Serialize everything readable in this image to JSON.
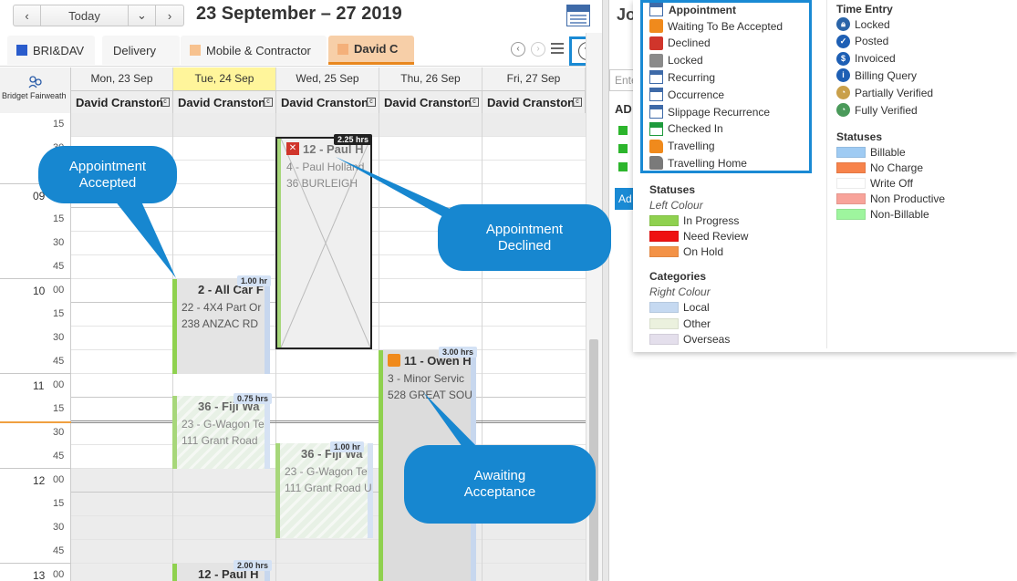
{
  "toolbar": {
    "prev": "‹",
    "today": "Today",
    "dropdown": "⌄",
    "next": "›",
    "range_title": "23 September – 27 2019"
  },
  "tabs": [
    {
      "label": "BRI&DAV",
      "color": "#2a5ccc"
    },
    {
      "label": "Delivery",
      "color": ""
    },
    {
      "label": "Mobile & Contractor",
      "color": "#f7c28f"
    },
    {
      "label": "David C",
      "color": "#f7c28f"
    }
  ],
  "tab_controls": {
    "prev": "‹",
    "next": "›",
    "help": "?"
  },
  "corner_label": "Bridget Fairweath",
  "days": [
    {
      "label": "Mon, 23 Sep",
      "resource": "David Cranston"
    },
    {
      "label": "Tue, 24 Sep",
      "resource": "David Cranston"
    },
    {
      "label": "Wed, 25 Sep",
      "resource": "David Cranston"
    },
    {
      "label": "Thu, 26 Sep",
      "resource": "David Cranston"
    },
    {
      "label": "Fri, 27 Sep",
      "resource": "David Cranston"
    }
  ],
  "resource_icon": "c",
  "time_rows": [
    {
      "hour": "",
      "min": "15"
    },
    {
      "hour": "",
      "min": "30"
    },
    {
      "hour": "",
      "min": "45"
    },
    {
      "hour": "09",
      "min": "00"
    },
    {
      "hour": "",
      "min": "15"
    },
    {
      "hour": "",
      "min": "30"
    },
    {
      "hour": "",
      "min": "45"
    },
    {
      "hour": "10",
      "min": "00"
    },
    {
      "hour": "",
      "min": "15"
    },
    {
      "hour": "",
      "min": "30"
    },
    {
      "hour": "",
      "min": "45"
    },
    {
      "hour": "11",
      "min": "00"
    },
    {
      "hour": "",
      "min": "15"
    },
    {
      "hour": "",
      "min": "30"
    },
    {
      "hour": "",
      "min": "45"
    },
    {
      "hour": "12",
      "min": "00"
    },
    {
      "hour": "",
      "min": "15"
    },
    {
      "hour": "",
      "min": "30"
    },
    {
      "hour": "",
      "min": "45"
    },
    {
      "hour": "13",
      "min": "00"
    }
  ],
  "appointments": [
    {
      "title": "12 - Paul H",
      "line2": "4 - Paul Holland",
      "line3": "36 BURLEIGH",
      "hours": "2.25 hrs",
      "status": "declined"
    },
    {
      "title": "2 - All Car F",
      "line2": "22 - 4X4 Part Or",
      "line3": "238 ANZAC RD",
      "hours": "1.00 hr",
      "status": "accepted"
    },
    {
      "title": "11 - Owen H",
      "line2": "3 - Minor Servic",
      "line3": "528 GREAT SOU",
      "hours": "3.00 hrs",
      "status": "waiting"
    },
    {
      "title": "36 - Fiji Wa",
      "line2": "23 - G-Wagon Te",
      "line3": "111 Grant Road",
      "hours": "0.75 hrs",
      "status": "accepted"
    },
    {
      "title": "36 - Fiji Wa",
      "line2": "23 - G-Wagon Te",
      "line3": "111 Grant Road U",
      "hours": "1.00 hr",
      "status": "accepted"
    },
    {
      "title": "12 - Paul H",
      "line2": "",
      "line3": "",
      "hours": "2.00 hrs",
      "status": "accepted"
    }
  ],
  "callouts": {
    "accepted": "Appointment Accepted",
    "declined": "Appointment Declined",
    "awaiting": "Awaiting Acceptance"
  },
  "side_panel": {
    "title": "Jo",
    "search_placeholder": "Ente",
    "section_label": "AD",
    "button_label": "Ad"
  },
  "legend": {
    "appointment_header": "Appointment",
    "appointment_items": [
      {
        "label": "Waiting To Be Accepted",
        "icon": "hourglass-calendar-icon"
      },
      {
        "label": "Declined",
        "icon": "declined-x-icon"
      },
      {
        "label": "Locked",
        "icon": "locked-calendar-icon"
      },
      {
        "label": "Recurring",
        "icon": "recurring-calendar-icon"
      },
      {
        "label": "Occurrence",
        "icon": "occurrence-calendar-icon"
      },
      {
        "label": "Slippage Recurrence",
        "icon": "slippage-calendar-icon"
      },
      {
        "label": "Checked In",
        "icon": "checked-in-icon"
      },
      {
        "label": "Travelling",
        "icon": "truck-icon"
      },
      {
        "label": "Travelling Home",
        "icon": "truck-home-icon"
      }
    ],
    "statuses_header": "Statuses",
    "statuses_sub": "Left Colour",
    "statuses": [
      {
        "label": "In Progress",
        "color": "#8fd14f"
      },
      {
        "label": "Need Review",
        "color": "#ee1111"
      },
      {
        "label": "On Hold",
        "color": "#f39247"
      }
    ],
    "categories_header": "Categories",
    "categories_sub": "Right Colour",
    "categories": [
      {
        "label": "Local",
        "color": "#c5d9f1"
      },
      {
        "label": "Other",
        "color": "#ebf1de"
      },
      {
        "label": "Overseas",
        "color": "#e4dfec"
      }
    ],
    "time_entry_header": "Time Entry",
    "time_entry": [
      {
        "label": "Locked",
        "icon": "lock-icon",
        "color": "#2a64a8"
      },
      {
        "label": "Posted",
        "icon": "check-icon",
        "color": "#1e5fb4"
      },
      {
        "label": "Invoiced",
        "icon": "dollar-icon",
        "color": "#1e5fb4"
      },
      {
        "label": "Billing Query",
        "icon": "info-icon",
        "color": "#1e5fb4"
      },
      {
        "label": "Partially Verified",
        "icon": "clock-icon",
        "color": "#c9a04a"
      },
      {
        "label": "Fully Verified",
        "icon": "clock-green-icon",
        "color": "#4a9a5a"
      }
    ],
    "statuses2_header": "Statuses",
    "statuses2": [
      {
        "label": "Billable",
        "color": "#9fcbf3"
      },
      {
        "label": "No Charge",
        "color": "#f7834b"
      },
      {
        "label": "Write Off",
        "color": "#ffffff"
      },
      {
        "label": "Non Productive",
        "color": "#f8a39a"
      },
      {
        "label": "Non-Billable",
        "color": "#9ef59e"
      }
    ]
  }
}
